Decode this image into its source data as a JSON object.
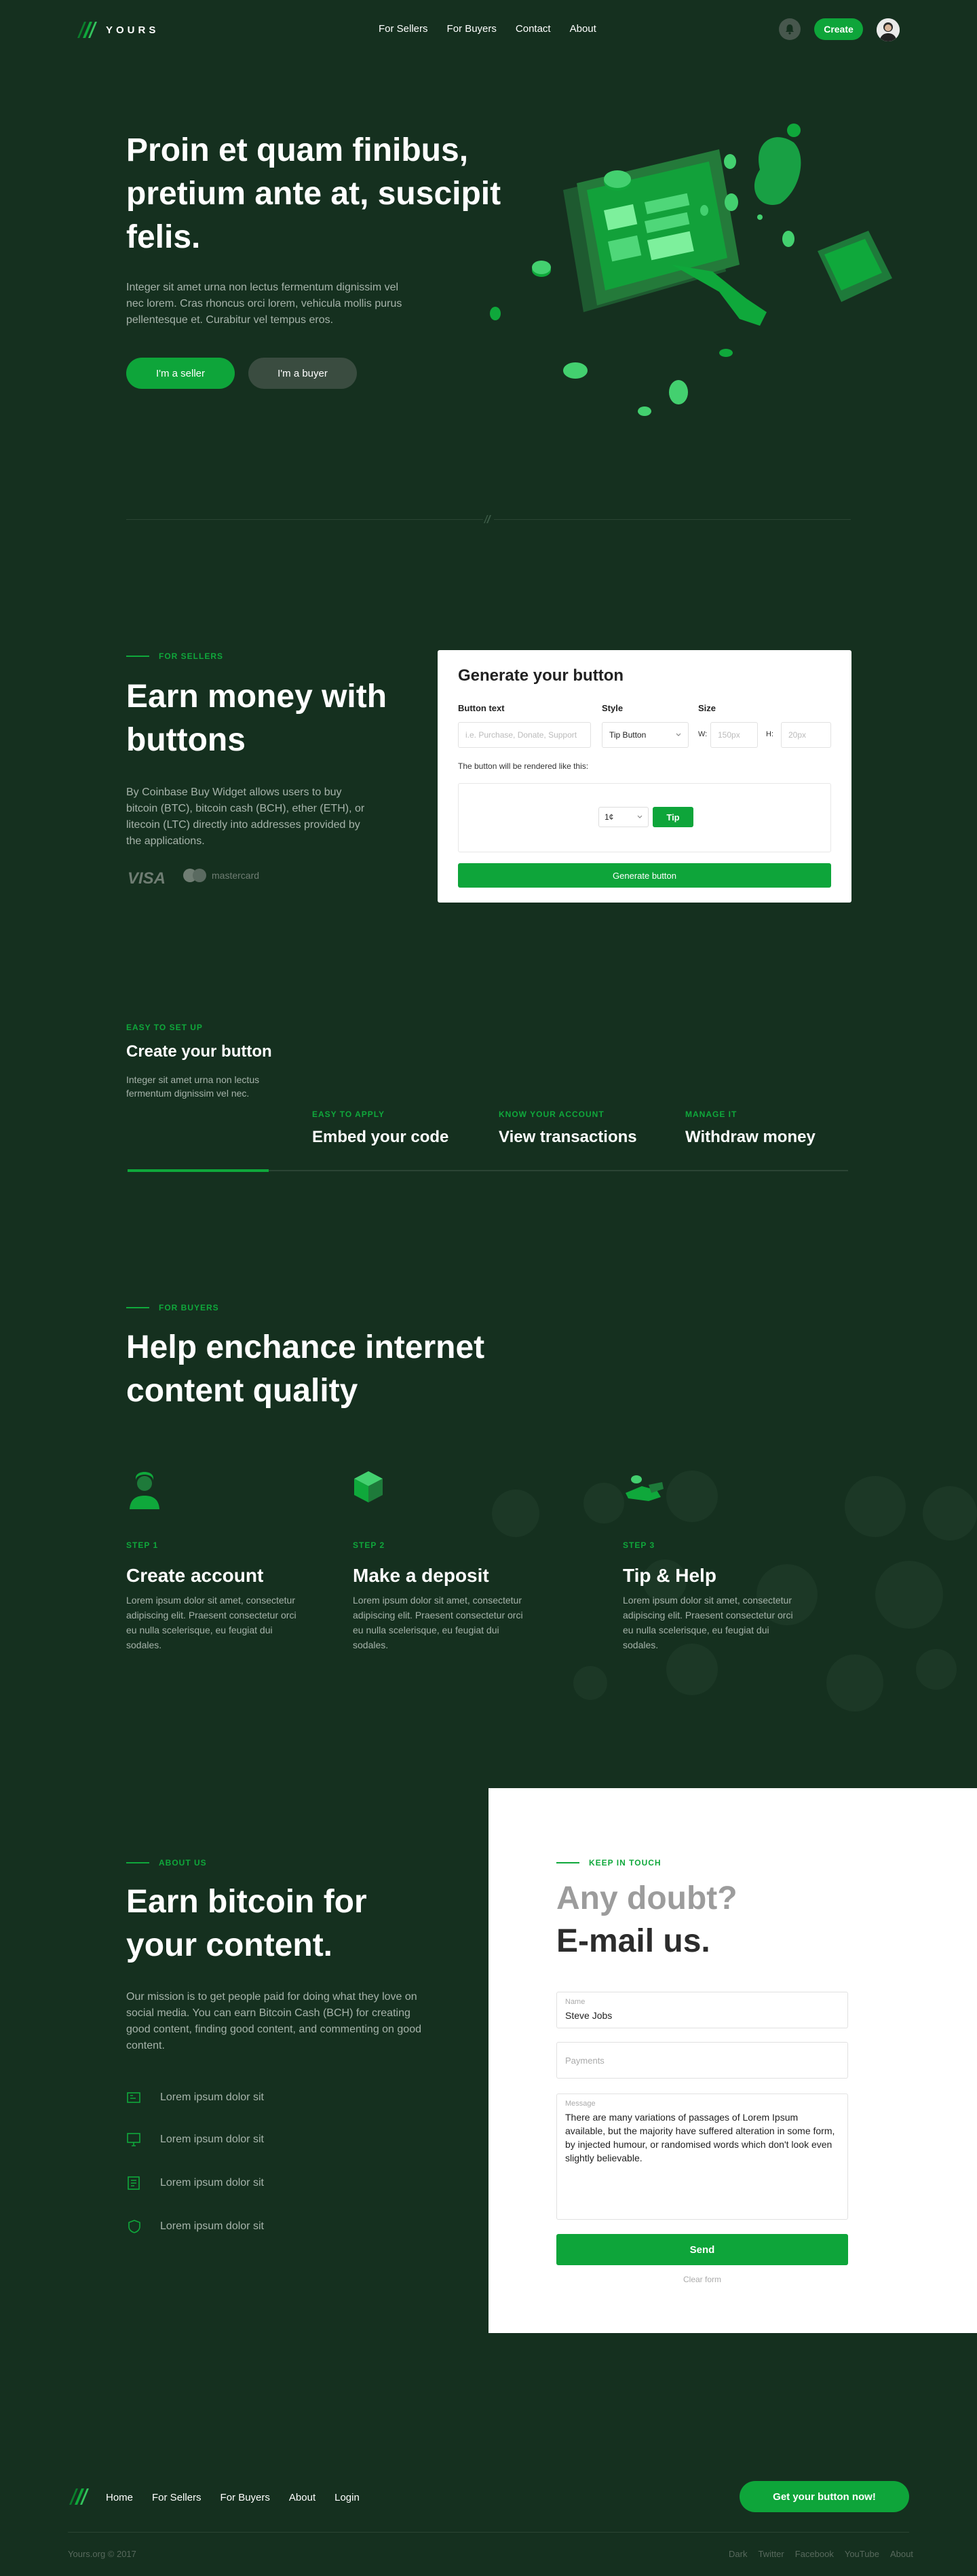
{
  "nav": {
    "brand": "YOURS",
    "links": [
      "For Sellers",
      "For Buyers",
      "Contact",
      "About"
    ],
    "create_label": "Create"
  },
  "hero": {
    "title": "Proin et quam finibus, pretium ante at, suscipit felis.",
    "subtitle": "Integer sit amet urna non lectus fermentum dignissim vel nec lorem. Cras rhoncus orci lorem, vehicula mollis purus pellentesque et. Curabitur vel tempus eros.",
    "seller_button": "I'm a seller",
    "buyer_button": "I'm a buyer"
  },
  "sellers": {
    "eyebrow": "FOR SELLERS",
    "title": "Earn money with buttons",
    "description": "By Coinbase Buy Widget   allows users to buy bitcoin (BTC), bitcoin cash (BCH), ether (ETH), or litecoin (LTC) directly into addresses provided by the applications.",
    "visa": "VISA",
    "mastercard": "mastercard"
  },
  "generator": {
    "title": "Generate your button",
    "button_text_label": "Button text",
    "button_text_placeholder": "i.e. Purchase, Donate, Support",
    "style_label": "Style",
    "style_value": "Tip Button",
    "size_label": "Size",
    "width_label": "W:",
    "width_placeholder": "150px",
    "height_label": "H:",
    "height_placeholder": "20px",
    "note": "The button will be rendered like this:",
    "preview_currency": "1¢",
    "preview_button": "Tip",
    "submit": "Generate button"
  },
  "setup_steps": [
    {
      "tag": "EASY TO SET UP",
      "name": "Create your button",
      "desc": "Integer sit amet urna non lectus fermentum dignissim vel nec."
    },
    {
      "tag": "EASY TO APPLY",
      "name": "Embed your code"
    },
    {
      "tag": "KNOW YOUR ACCOUNT",
      "name": "View transactions"
    },
    {
      "tag": "MANAGE IT",
      "name": "Withdraw money"
    }
  ],
  "buyers": {
    "eyebrow": "FOR BUYERS",
    "title": "Help enchance internet content quality",
    "steps": [
      {
        "tag": "STEP 1",
        "name": "Create account",
        "desc": "Lorem ipsum dolor sit amet, consectetur adipiscing elit. Praesent consectetur orci eu nulla scelerisque, eu feugiat dui sodales.",
        "icon": "user-icon"
      },
      {
        "tag": "STEP 2",
        "name": "Make a deposit",
        "desc": "Lorem ipsum dolor sit amet, consectetur adipiscing elit. Praesent consectetur orci eu nulla scelerisque, eu feugiat dui sodales.",
        "icon": "cube-icon"
      },
      {
        "tag": "STEP 3",
        "name": "Tip & Help",
        "desc": "Lorem ipsum dolor sit amet, consectetur adipiscing elit. Praesent consectetur orci eu nulla scelerisque, eu feugiat dui sodales.",
        "icon": "hand-coin-icon"
      }
    ]
  },
  "about": {
    "eyebrow": "ABOUT US",
    "title": "Earn bitcoin for your content.",
    "description": "Our mission is to get people paid for doing what they love on social media. You can earn Bitcoin Cash (BCH) for creating good content, finding good content, and commenting on good content.",
    "features": [
      "Lorem ipsum dolor sit",
      "Lorem ipsum dolor sit",
      "Lorem ipsum dolor sit",
      "Lorem ipsum dolor sit"
    ]
  },
  "contact": {
    "eyebrow": "KEEP IN TOUCH",
    "question": "Any doubt?",
    "email_us": "E-mail us.",
    "name_label": "Name",
    "name_value": "Steve Jobs",
    "payments_placeholder": "Payments",
    "message_label": "Message",
    "message_value": "There are many variations of passages of Lorem Ipsum available, but the majority have suffered alteration in some form, by injected humour, or randomised words which don't look even slightly believable.",
    "send": "Send",
    "clear": "Clear form"
  },
  "footer": {
    "links": [
      "Home",
      "For Sellers",
      "For Buyers",
      "About",
      "Login"
    ],
    "cta": "Get your button now!",
    "copyright": "Yours.org © 2017",
    "social": [
      "Dark",
      "Twitter",
      "Facebook",
      "YouTube",
      "About"
    ]
  },
  "colors": {
    "background": "#15301f",
    "accent": "#0fa83b",
    "muted_text": "#a6b3aa"
  }
}
